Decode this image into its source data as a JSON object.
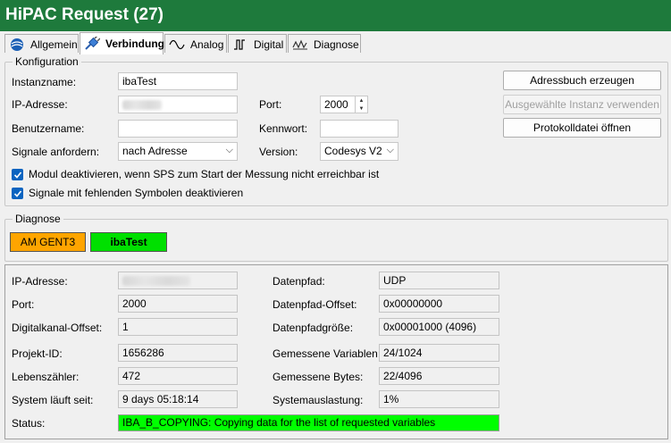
{
  "window": {
    "title": "HiPAC Request (27)"
  },
  "tabs": [
    {
      "label": "Allgemein",
      "icon": "globe-icon"
    },
    {
      "label": "Verbindung",
      "icon": "plug-icon"
    },
    {
      "label": "Analog",
      "icon": "sine-wave-icon"
    },
    {
      "label": "Digital",
      "icon": "digital-signal-icon"
    },
    {
      "label": "Diagnose",
      "icon": "diagnose-icon"
    }
  ],
  "config": {
    "group_label": "Konfiguration",
    "instance_name_label": "Instanzname:",
    "instance_name_value": "ibaTest",
    "ip_label": "IP-Adresse:",
    "port_label": "Port:",
    "port_value": "2000",
    "user_label": "Benutzername:",
    "password_label": "Kennwort:",
    "signals_label": "Signale anfordern:",
    "signals_value": "nach Adresse",
    "version_label": "Version:",
    "version_value": "Codesys V2",
    "chk_deactivate_label": "Modul deaktivieren, wenn SPS zum Start der Messung nicht erreichbar ist",
    "chk_missing_label": "Signale mit fehlenden Symbolen deaktivieren",
    "btn_addressbook": "Adressbuch erzeugen",
    "btn_use_instance": "Ausgewählte Instanz verwenden",
    "btn_open_log": "Protokolldatei öffnen"
  },
  "diagnose": {
    "group_label": "Diagnose",
    "status_boxes": [
      {
        "label": "AM GENT3",
        "color": "#ffa500"
      },
      {
        "label": "ibaTest",
        "color": "#00e000"
      }
    ],
    "fields_left": [
      {
        "label": "IP-Adresse:",
        "value": ""
      },
      {
        "label": "Port:",
        "value": "2000"
      },
      {
        "label": "Digitalkanal-Offset:",
        "value": "1"
      },
      {
        "label": "Projekt-ID:",
        "value": "1656286"
      },
      {
        "label": "Lebenszähler:",
        "value": "472"
      },
      {
        "label": "System läuft seit:",
        "value": "9 days 05:18:14"
      }
    ],
    "fields_right": [
      {
        "label": "Datenpfad:",
        "value": "UDP"
      },
      {
        "label": "Datenpfad-Offset:",
        "value": "0x00000000"
      },
      {
        "label": "Datenpfadgröße:",
        "value": "0x00001000 (4096)"
      },
      {
        "label": "Gemessene Variablen:",
        "value": "24/1024"
      },
      {
        "label": "Gemessene Bytes:",
        "value": "22/4096"
      },
      {
        "label": "Systemauslastung:",
        "value": "1%"
      }
    ],
    "status_label": "Status:",
    "status_value": "IBA_B_COPYING: Copying data for the list of requested variables",
    "status_color": "#00ff00"
  }
}
